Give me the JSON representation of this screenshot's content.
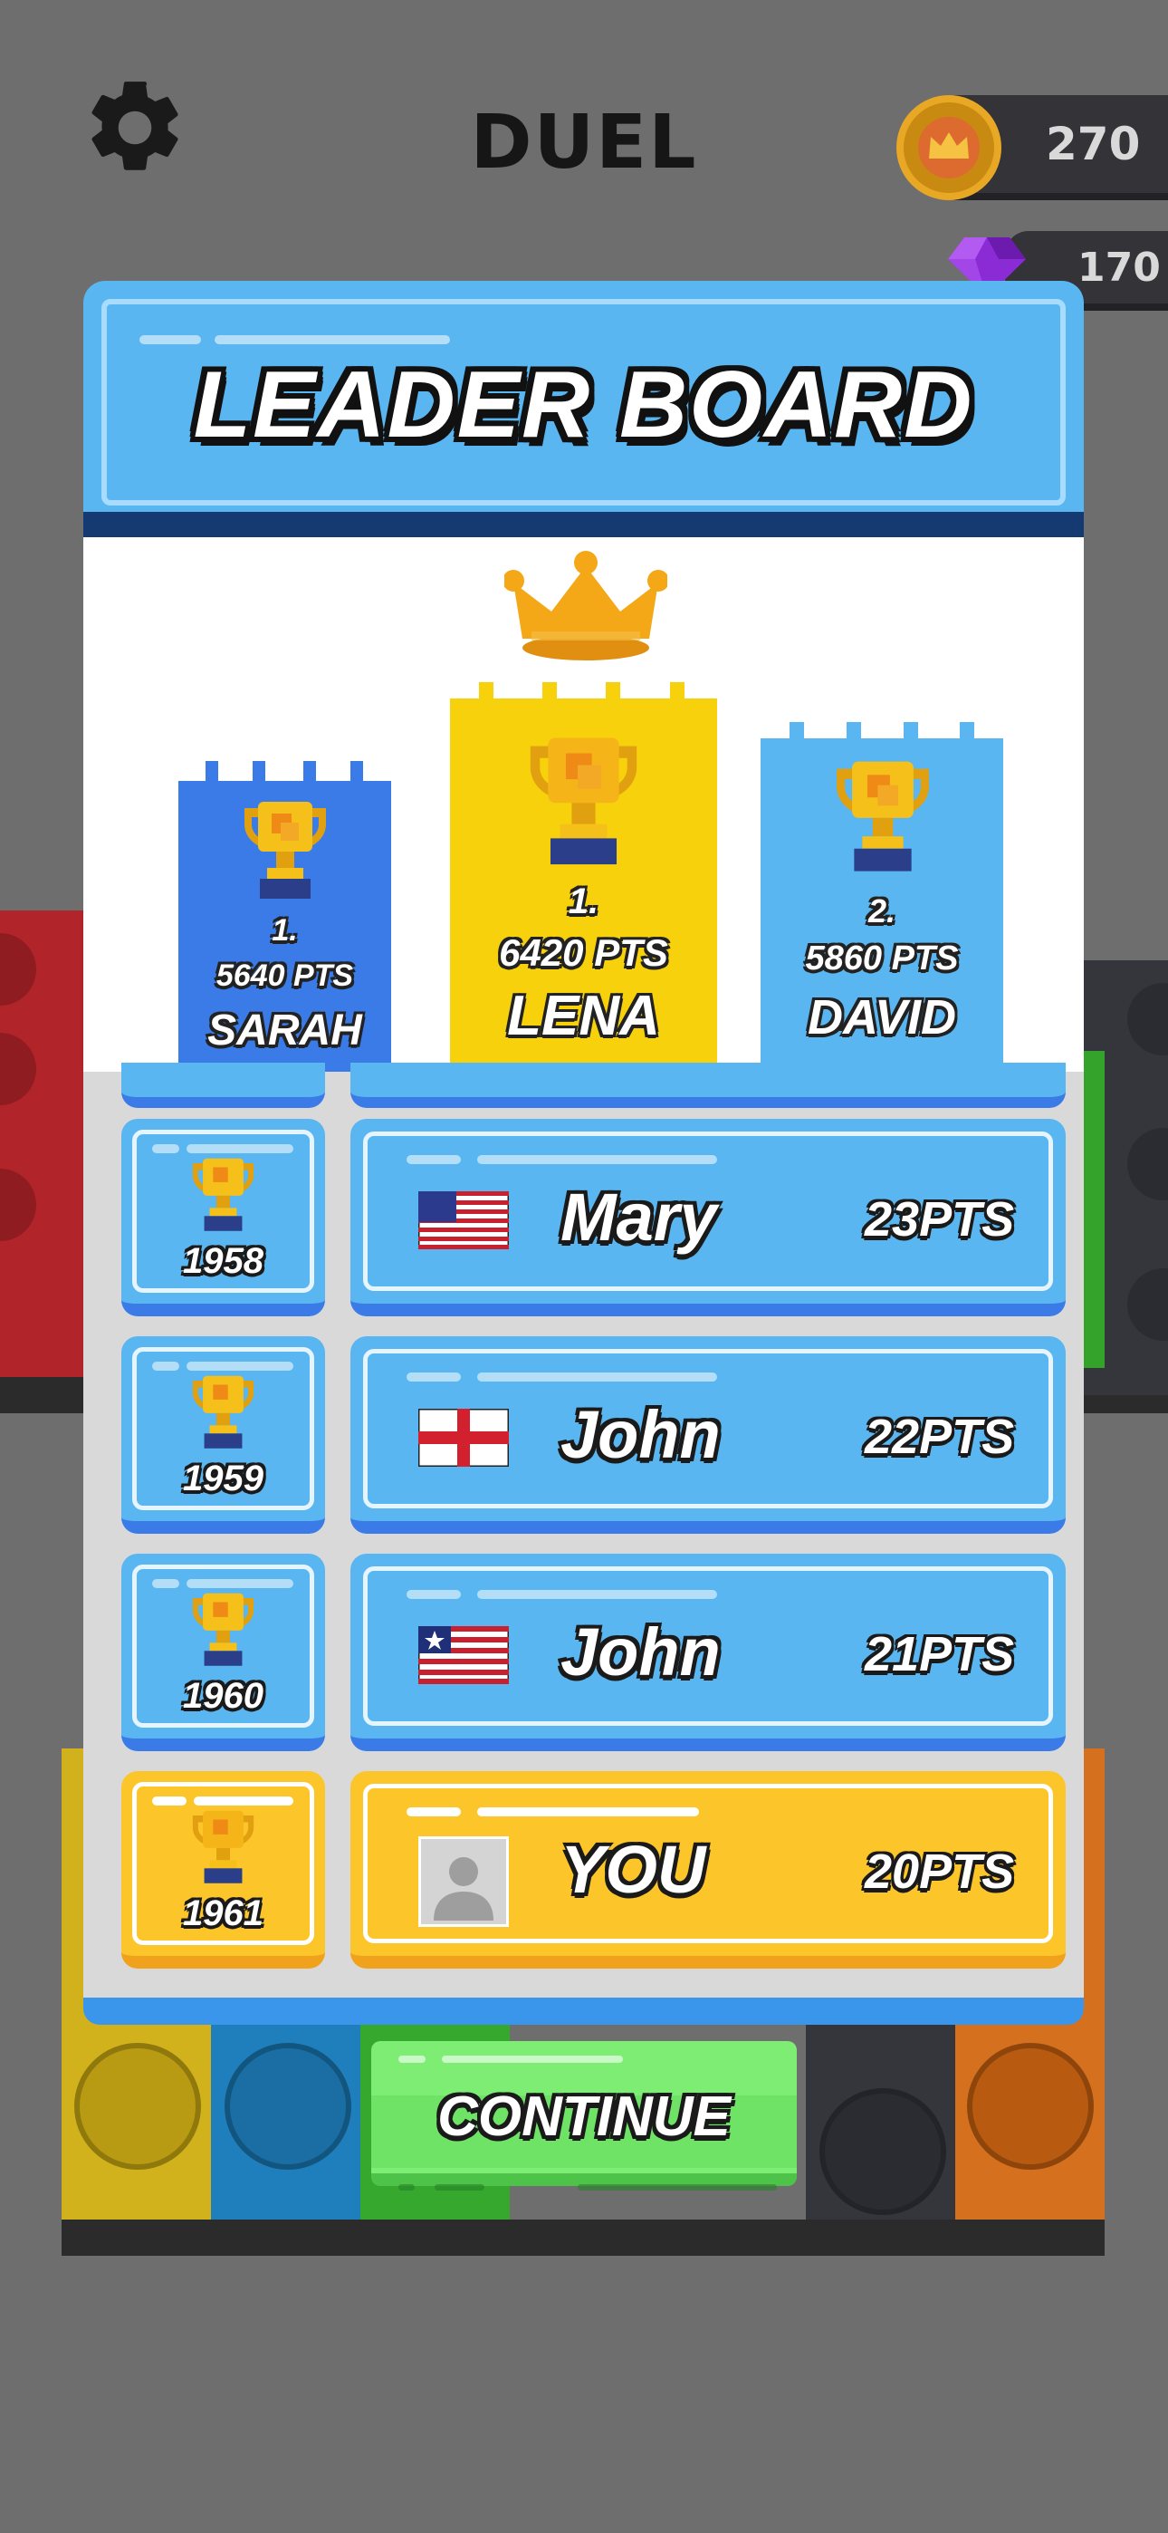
{
  "top_bar": {
    "title": "DUEL",
    "coins": "270",
    "gems": "170",
    "settings_icon": "gear-icon",
    "coin_icon": "crown-coin-icon",
    "gem_icon": "gem-icon"
  },
  "leaderboard": {
    "title": "LEADER BOARD",
    "crown_icon": "crown-icon",
    "podium": [
      {
        "rank": "1.",
        "points": "5640 PTS",
        "name": "SARAH",
        "color": "#3a7be8"
      },
      {
        "rank": "1.",
        "points": "6420 PTS",
        "name": "LENA",
        "color": "#f7d10c"
      },
      {
        "rank": "2.",
        "points": "5860 PTS",
        "name": "DAVID",
        "color": "#5ab6f0"
      }
    ],
    "rows": [
      {
        "rank": "1958",
        "flag": "us-flag-icon",
        "name": "Mary",
        "points": "23PTS"
      },
      {
        "rank": "1959",
        "flag": "england-flag-icon",
        "name": "John",
        "points": "22PTS"
      },
      {
        "rank": "1960",
        "flag": "liberia-flag-icon",
        "name": "John",
        "points": "21PTS"
      },
      {
        "rank": "1961",
        "flag": "avatar-placeholder-icon",
        "name": "YOU",
        "points": "20PTS"
      }
    ]
  },
  "continue_label": "CONTINUE",
  "colors": {
    "blue": "#5ab6f0",
    "dark_blue": "#3a7be8",
    "yellow": "#fcc62b",
    "green": "#7ded74"
  }
}
